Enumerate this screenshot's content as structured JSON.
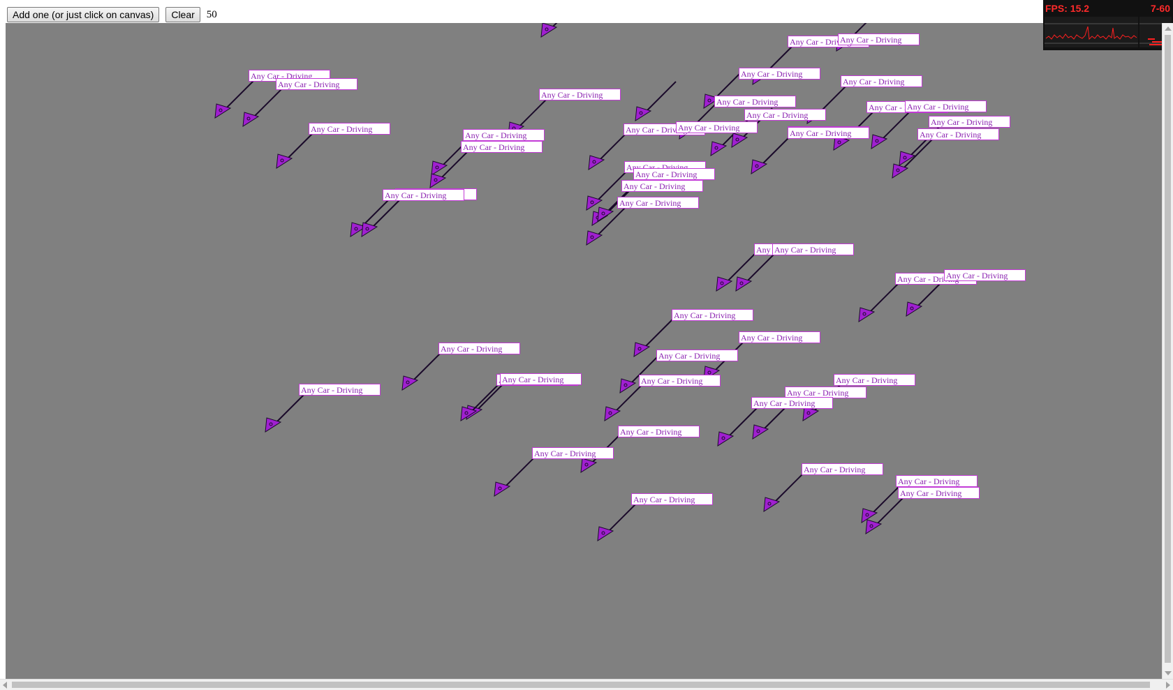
{
  "toolbar": {
    "add_label": "Add one (or just click on canvas)",
    "clear_label": "Clear",
    "count": "50"
  },
  "car_label_text": "Any Car - Driving",
  "colors": {
    "canvas_bg": "#808080",
    "car_fill": "#a020d0",
    "car_stroke": "#1a0a2a",
    "label_border": "#c23ad6",
    "label_text": "#8a1fb0"
  },
  "stats": {
    "fps_label": "FPS: 15.2",
    "range_label": "7-60"
  }
}
